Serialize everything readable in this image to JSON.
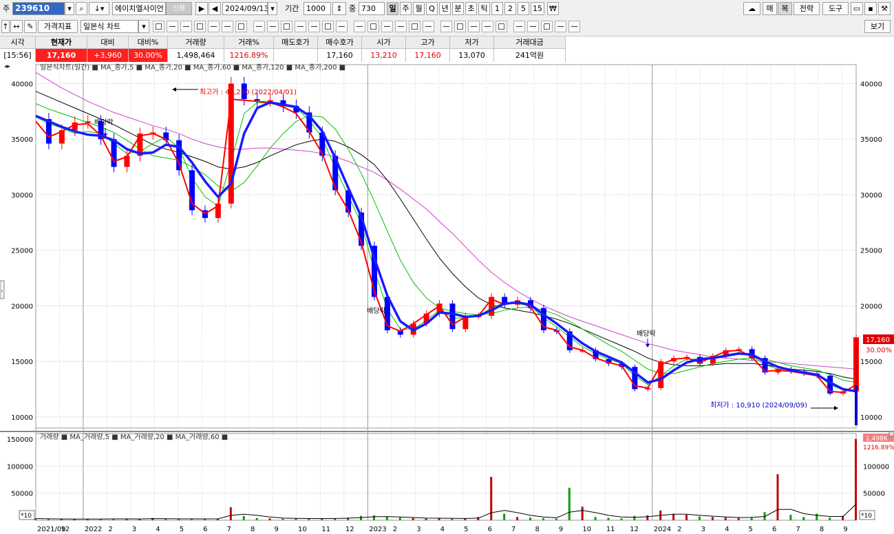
{
  "toolbar1": {
    "code_prefix": "주",
    "code": "239610",
    "name": "에이치엘사이언",
    "date": "2024/09/13",
    "period_label": "기간",
    "period_value": "1000",
    "mid_label": "중",
    "mid_value": "730",
    "period_tabs": [
      "일",
      "주",
      "월",
      "Q",
      "년",
      "분",
      "초",
      "틱",
      "1",
      "2",
      "5",
      "15"
    ],
    "active_tab": "일",
    "right_buttons": [
      "매",
      "복",
      "전략",
      "도구"
    ]
  },
  "toolbar2": {
    "indicator_button": "가격지표",
    "chart_type": "일본식 차트",
    "view_button": "보기"
  },
  "quote": {
    "headers": [
      "시각",
      "현재가",
      "대비",
      "대비%",
      "거래량",
      "거래%",
      "매도호가",
      "매수호가",
      "시가",
      "고가",
      "저가",
      "거래대금"
    ],
    "values": [
      "[15:56]",
      "17,160",
      "+3,960",
      "30.00%",
      "1,498,464",
      "1216.89%",
      "",
      "17,160",
      "13,210",
      "17,160",
      "13,070",
      "241억원"
    ]
  },
  "colors": {
    "up": "#ff0000",
    "down": "#0000ff",
    "ma5": "#ff0000",
    "ma20": "#00c000",
    "ma60": "#1a1aff",
    "ma120": "#00c000",
    "ma200": "#000000",
    "ma_long": "#d040d0"
  },
  "chart_data": {
    "type": "line",
    "price_legend": "일본식차트(일간) ■ MA_종가,5 ■ MA_종가,20 ■ MA_종가,60 ■ MA_종가,120 ■ MA_종가,200 ■",
    "volume_legend": "거래량 ■ MA_거래량,5 ■ MA_거래량,20 ■ MA_거래량,60 ■",
    "y_ticks": [
      10000,
      15000,
      20000,
      25000,
      30000,
      35000,
      40000
    ],
    "y_tick_labels": [
      "10000",
      "15000",
      "20000",
      "25000",
      "30000",
      "35000",
      "40000"
    ],
    "ylim": [
      9000,
      41700
    ],
    "vol_ticks": [
      50000,
      100000,
      150000
    ],
    "vol_tick_labels": [
      "50000",
      "100000",
      "150000"
    ],
    "vol_ylim": [
      0,
      160000
    ],
    "x_tick_labels": [
      "2021/09",
      "12",
      "2022",
      "2",
      "3",
      "4",
      "5",
      "6",
      "7",
      "8",
      "9",
      "10",
      "11",
      "12",
      "2023",
      "2",
      "3",
      "4",
      "5",
      "6",
      "7",
      "8",
      "9",
      "10",
      "11",
      "12",
      "2024",
      "2",
      "3",
      "4",
      "5",
      "6",
      "7",
      "8",
      "9"
    ],
    "annotations": {
      "high": "최고가 : 40,250 (2022/04/01)",
      "low": "최저가 : 10,910 (2024/09/09)",
      "dividend": "배당락"
    },
    "last_price_label": "17,160",
    "last_pct_label": "30.00%",
    "last_vol_label": "1,498K",
    "last_vol_pct_label": "1216.89%",
    "scale_label": "*10",
    "price_series": [
      36800,
      34600,
      35800,
      36500,
      36600,
      35000,
      32500,
      33500,
      35500,
      35600,
      34900,
      32200,
      28600,
      27900,
      29200,
      40000,
      38600,
      38500,
      38500,
      38000,
      37400,
      35600,
      33500,
      30400,
      28400,
      25400,
      20800,
      17800,
      17400,
      18400,
      19300,
      20200,
      17900,
      19100,
      19100,
      20800,
      20100,
      20500,
      19800,
      17800,
      17700,
      16000,
      16000,
      15200,
      14800,
      14500,
      12500,
      12600,
      15000,
      15300,
      15400,
      14800,
      15500,
      16000,
      16100,
      15300,
      14000,
      14300,
      14100,
      13900,
      13700,
      12100,
      12300,
      17160
    ],
    "ma5": [
      36600,
      35200,
      35700,
      36300,
      36400,
      35300,
      33000,
      33400,
      35300,
      35500,
      35000,
      32800,
      29200,
      28300,
      29000,
      38600,
      38500,
      38400,
      38300,
      37900,
      37300,
      35700,
      33700,
      30600,
      28600,
      25700,
      21300,
      18200,
      17700,
      18400,
      19200,
      20000,
      18300,
      19000,
      19100,
      20600,
      20100,
      20400,
      19900,
      18100,
      17800,
      16300,
      16000,
      15300,
      14900,
      14600,
      12800,
      12600,
      14700,
      15200,
      15300,
      14900,
      15400,
      15900,
      16000,
      15400,
      14100,
      14200,
      14100,
      13900,
      13700,
      12300,
      12200,
      12900
    ],
    "ma20": [
      37000,
      36400,
      36000,
      35500,
      35700,
      35500,
      34600,
      33700,
      33900,
      34600,
      35200,
      34200,
      31500,
      29800,
      29000,
      33000,
      37300,
      38300,
      38200,
      38000,
      37800,
      36700,
      35100,
      32400,
      29900,
      27400,
      23200,
      19700,
      17900,
      17900,
      18700,
      19600,
      18900,
      18900,
      19100,
      19800,
      20300,
      20200,
      20000,
      18900,
      18100,
      17200,
      16300,
      15700,
      15200,
      14800,
      13700,
      12900,
      13700,
      14600,
      15200,
      15200,
      15300,
      15600,
      15800,
      15500,
      14700,
      14300,
      14200,
      14000,
      13800,
      12900,
      12400,
      12300
    ],
    "ma60": [
      37100,
      36600,
      36100,
      35700,
      35400,
      35300,
      34900,
      34100,
      33700,
      33800,
      34500,
      34300,
      32900,
      31200,
      29800,
      31000,
      35500,
      37800,
      38300,
      38100,
      37900,
      37100,
      35700,
      33300,
      30600,
      28000,
      24300,
      20900,
      18600,
      17800,
      18400,
      19400,
      19300,
      19000,
      19100,
      19600,
      20200,
      20300,
      20100,
      19200,
      18400,
      17500,
      16600,
      15900,
      15400,
      14900,
      14000,
      13100,
      13400,
      14200,
      14900,
      15200,
      15300,
      15500,
      15700,
      15600,
      15000,
      14500,
      14200,
      14000,
      13800,
      13100,
      12500,
      12300
    ],
    "ma120": [
      38200,
      37700,
      37300,
      36900,
      36500,
      36100,
      35600,
      34900,
      34100,
      33500,
      33300,
      33100,
      32500,
      31800,
      30800,
      30300,
      31100,
      32600,
      34200,
      35500,
      36600,
      37100,
      37000,
      35900,
      34100,
      31900,
      29400,
      26700,
      24100,
      22100,
      20700,
      19800,
      19500,
      19300,
      19200,
      19300,
      19600,
      19800,
      19900,
      19600,
      19200,
      18600,
      17900,
      17200,
      16500,
      15900,
      15100,
      14300,
      13900,
      13900,
      14200,
      14500,
      14800,
      15000,
      15200,
      15300,
      15200,
      14900,
      14600,
      14400,
      14200,
      13800,
      13300,
      13100
    ],
    "ma200": [
      39300,
      38800,
      38300,
      37800,
      37300,
      36800,
      36300,
      35700,
      35100,
      34500,
      34100,
      33800,
      33400,
      33000,
      32500,
      32300,
      32500,
      32900,
      33500,
      34000,
      34500,
      34800,
      35000,
      34800,
      34300,
      33600,
      32700,
      31300,
      29600,
      27800,
      26000,
      24300,
      22900,
      21700,
      20700,
      20100,
      19800,
      19600,
      19400,
      19100,
      18800,
      18400,
      17900,
      17400,
      16900,
      16400,
      15900,
      15300,
      14900,
      14700,
      14600,
      14600,
      14700,
      14800,
      14800,
      14800,
      14700,
      14500,
      14300,
      14200,
      14100,
      13900,
      13600,
      13400
    ],
    "ma_long": [
      41000,
      40300,
      39600,
      39000,
      38400,
      37900,
      37400,
      37000,
      36600,
      36200,
      35900,
      35500,
      35000,
      34600,
      34300,
      34100,
      34100,
      34200,
      34200,
      34100,
      34000,
      33900,
      33700,
      33400,
      33000,
      32500,
      32000,
      31300,
      30500,
      29600,
      28700,
      27600,
      26500,
      25300,
      24100,
      23000,
      22100,
      21300,
      20600,
      20000,
      19500,
      19000,
      18600,
      18200,
      17800,
      17400,
      17000,
      16600,
      16300,
      16000,
      15800,
      15600,
      15400,
      15300,
      15200,
      15100,
      15000,
      14900,
      14800,
      14700,
      14600,
      14500,
      14400,
      14300
    ],
    "volume_series": [
      3000,
      2500,
      2000,
      2000,
      2200,
      2500,
      3000,
      2500,
      2000,
      4000,
      2500,
      2000,
      3000,
      2500,
      3000,
      24000,
      8000,
      4000,
      3500,
      3000,
      3000,
      3500,
      3000,
      3500,
      5000,
      8000,
      9000,
      6000,
      5000,
      4000,
      3000,
      4000,
      3000,
      3500,
      6000,
      80000,
      12000,
      6000,
      5000,
      4000,
      3000,
      60000,
      25000,
      6000,
      4500,
      3500,
      8000,
      9000,
      18000,
      12000,
      10000,
      7000,
      6000,
      5000,
      4500,
      6000,
      15000,
      85000,
      10000,
      6000,
      12000,
      5000,
      8000,
      150000
    ],
    "volume_ma": [
      3000,
      2700,
      2400,
      2200,
      2200,
      2300,
      2600,
      2600,
      2400,
      3000,
      2900,
      2600,
      2600,
      2600,
      2700,
      9000,
      11000,
      9000,
      6000,
      4000,
      3400,
      3200,
      3200,
      3300,
      3800,
      5000,
      6500,
      6800,
      6000,
      5000,
      4000,
      3800,
      3400,
      3300,
      4000,
      14000,
      18000,
      14000,
      9000,
      6000,
      4500,
      15000,
      18000,
      14000,
      9000,
      6000,
      5500,
      6500,
      9000,
      11000,
      11000,
      9000,
      7500,
      6000,
      5000,
      5200,
      7000,
      20000,
      20000,
      12000,
      9000,
      7000,
      7000,
      30000
    ]
  }
}
